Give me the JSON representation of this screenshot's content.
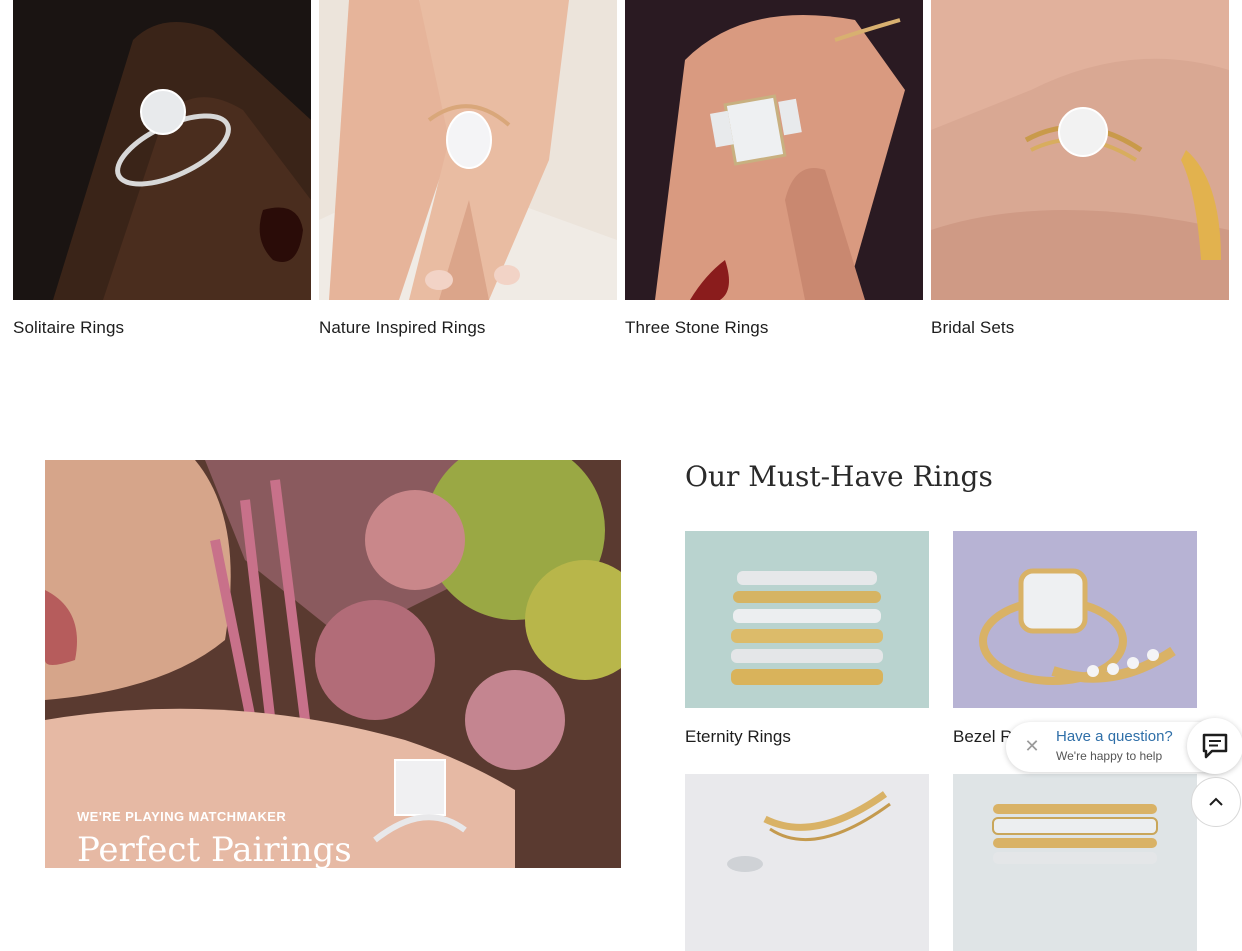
{
  "top_categories": [
    {
      "label": "Solitaire Rings",
      "image": "solitaire-ring-photo"
    },
    {
      "label": "Nature Inspired Rings",
      "image": "nature-ring-photo"
    },
    {
      "label": "Three Stone Rings",
      "image": "three-stone-ring-photo"
    },
    {
      "label": "Bridal Sets",
      "image": "bridal-set-photo"
    }
  ],
  "promo": {
    "eyebrow": "WE'RE PLAYING MATCHMAKER",
    "title": "Perfect Pairings"
  },
  "must_have": {
    "title": "Our Must-Have Rings",
    "items": [
      {
        "label": "Eternity Rings"
      },
      {
        "label": "Bezel R"
      },
      {
        "label": ""
      },
      {
        "label": ""
      }
    ]
  },
  "chat": {
    "title": "Have a question?",
    "subtitle": "We're happy to help",
    "close_icon": "close-icon",
    "button_icon": "chat-bubble-icon"
  },
  "scroll_top": {
    "icon": "chevron-up-icon"
  }
}
